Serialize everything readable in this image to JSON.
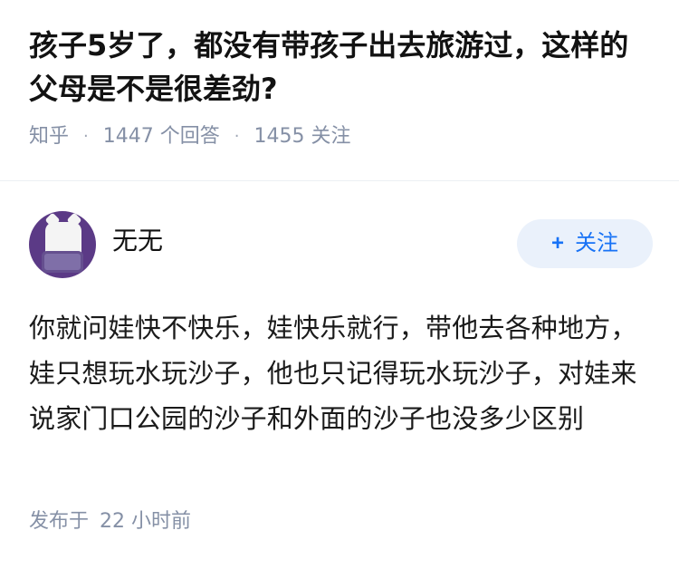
{
  "question": {
    "title": "孩子5岁了，都没有带孩子出去旅游过，这样的父母是不是很差劲?",
    "source": "知乎",
    "answers_count": "1447",
    "answers_label": "个回答",
    "followers_count": "1455",
    "followers_label": "关注",
    "separator": "·"
  },
  "answer": {
    "author_name": "无无",
    "follow_label": "关注",
    "follow_icon": "+",
    "content": "你就问娃快不快乐，娃快乐就行，带他去各种地方，娃只想玩水玩沙子，他也只记得玩水玩沙子，对娃来说家门口公园的沙子和外面的沙子也没多少区别",
    "published_label": "发布于",
    "published_time": "22 小时前"
  },
  "colors": {
    "title": "#121212",
    "meta": "#8590a6",
    "follow_bg": "#eaf1fb",
    "follow_text": "#1772f6",
    "avatar_bg": "#5b3a86"
  }
}
